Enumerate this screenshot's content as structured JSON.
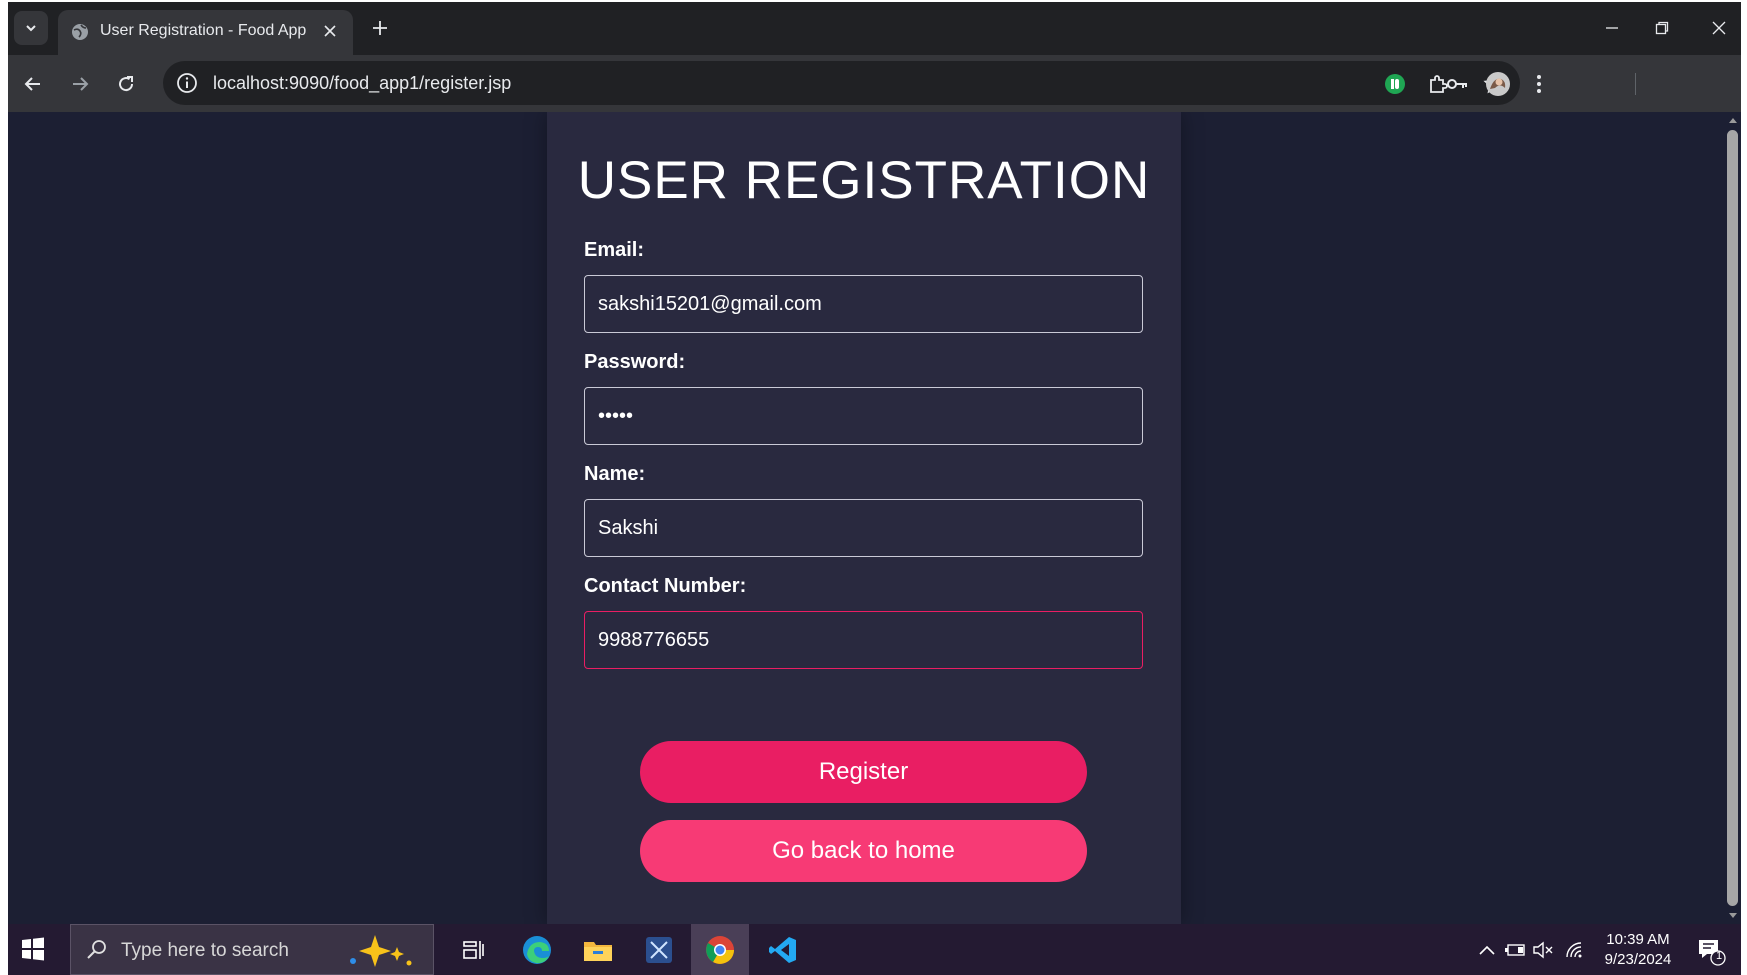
{
  "browser": {
    "tab_title": "User Registration - Food App",
    "url": "localhost:9090/food_app1/register.jsp"
  },
  "form": {
    "heading": "USER REGISTRATION",
    "email_label": "Email:",
    "email_value": "sakshi15201@gmail.com",
    "password_label": "Password:",
    "password_value": "•••••",
    "name_label": "Name:",
    "name_value": "Sakshi",
    "contact_label": "Contact Number:",
    "contact_value": "9988776655",
    "register_label": "Register",
    "home_label": "Go back to home"
  },
  "taskbar": {
    "search_placeholder": "Type here to search",
    "time": "10:39 AM",
    "date": "9/23/2024",
    "notification_count": "1"
  },
  "colors": {
    "accent": "#e91e63",
    "accent_light": "#f73a75",
    "page_bg": "#1c1f33",
    "card_bg": "#29293f"
  }
}
